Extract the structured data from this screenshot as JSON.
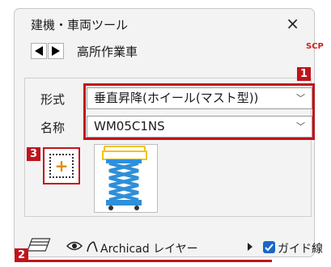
{
  "window": {
    "title": "建機・車両ツール",
    "close_label": "×"
  },
  "toolbar": {
    "tool_name": "高所作業車",
    "scp_label": "SCP"
  },
  "form": {
    "type_label": "形式",
    "type_value": "垂直昇降(ホイール(マスト型))",
    "name_label": "名称",
    "name_value": "WM05C1NS"
  },
  "badges": {
    "b1": "1",
    "b2": "2",
    "b3": "3"
  },
  "add_button": {
    "symbol": "+"
  },
  "bottom": {
    "layer_text": "Archicad レイヤー",
    "guide_label": "ガイド線",
    "guide_checked": true
  },
  "colors": {
    "accent_red": "#c0141b",
    "check_blue": "#1a66c9",
    "lift_blue": "#2f8fd8",
    "lift_yellow": "#f2c417",
    "plus_orange": "#e38a00"
  }
}
